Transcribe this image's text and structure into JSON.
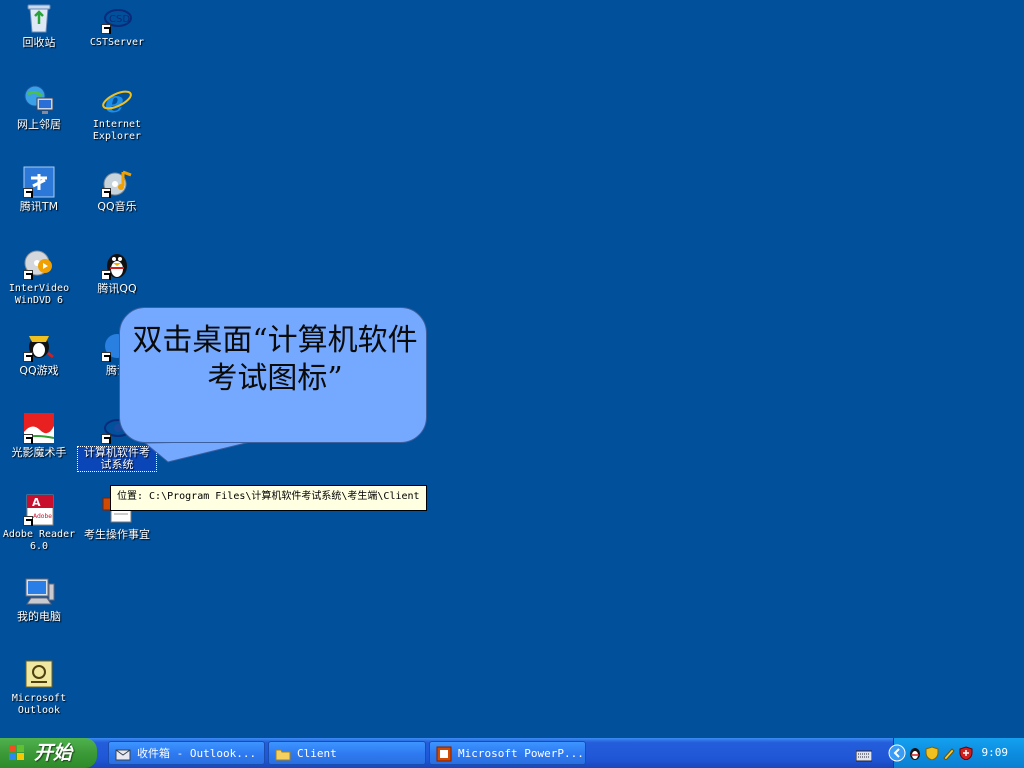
{
  "desktop": {
    "icons": [
      {
        "label": "回收站"
      },
      {
        "label": "CSTServer"
      },
      {
        "label": "网上邻居"
      },
      {
        "label": "Internet\nExplorer"
      },
      {
        "label": "腾讯TM"
      },
      {
        "label": "QQ音乐"
      },
      {
        "label": "InterVideo\nWinDVD 6"
      },
      {
        "label": "腾讯QQ"
      },
      {
        "label": "QQ游戏"
      },
      {
        "label": "腾讯"
      },
      {
        "label": "光影魔术手"
      },
      {
        "label": "计算机软件考\n试系统"
      },
      {
        "label": "Adobe Reader\n6.0"
      },
      {
        "label": "考生操作事宜"
      },
      {
        "label": "我的电脑"
      },
      {
        "label": "Microsoft\nOutlook"
      }
    ]
  },
  "callout": {
    "text": "双击桌面“计算机软件考试图标”"
  },
  "tooltip": {
    "text": "位置: C:\\Program Files\\计算机软件考试系统\\考生端\\Client"
  },
  "taskbar": {
    "start_label": "开始",
    "tasks": [
      {
        "label": "收件箱 - Outlook..."
      },
      {
        "label": "Client"
      },
      {
        "label": "Microsoft PowerP..."
      }
    ],
    "clock": "9:09"
  }
}
